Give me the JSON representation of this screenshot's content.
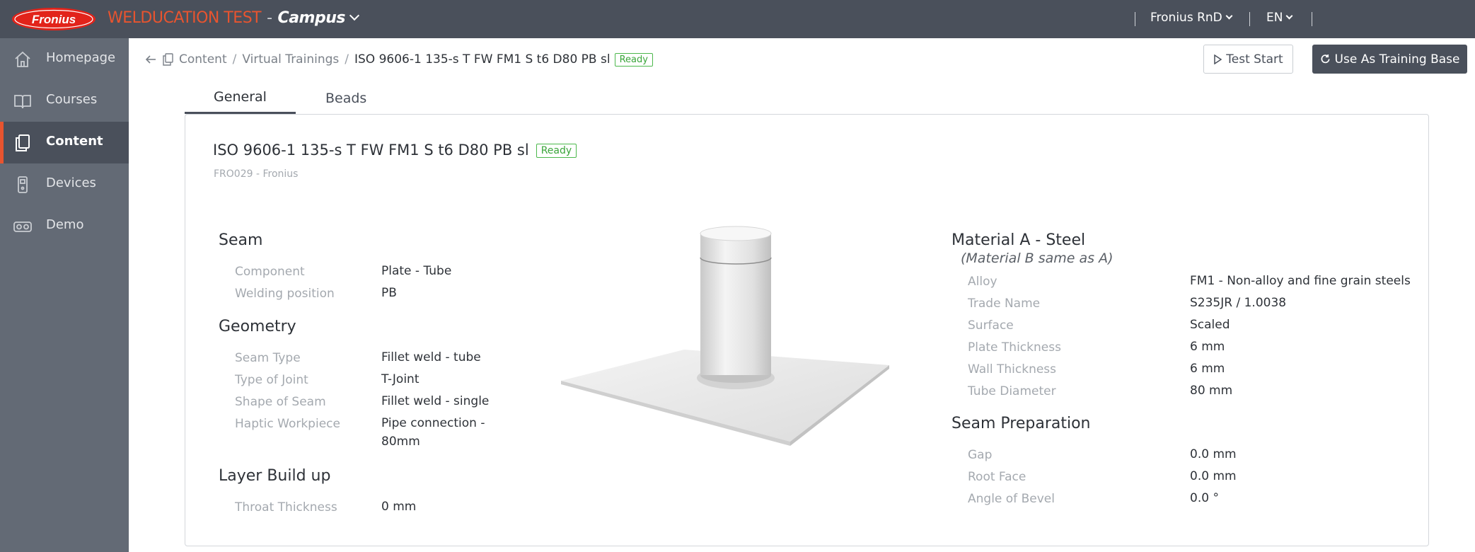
{
  "topbar": {
    "logo_text": "Fronius",
    "app_name": "WELDUCATION TEST",
    "separator": "-",
    "campus": "Campus",
    "org": "Fronius RnD",
    "language": "EN"
  },
  "sidebar": {
    "items": [
      {
        "label": "Homepage",
        "icon": "home-icon"
      },
      {
        "label": "Courses",
        "icon": "book-icon"
      },
      {
        "label": "Content",
        "icon": "content-icon",
        "active": true
      },
      {
        "label": "Devices",
        "icon": "device-icon"
      },
      {
        "label": "Demo",
        "icon": "vr-glasses-icon"
      }
    ]
  },
  "breadcrumb": {
    "items": [
      "Content",
      "Virtual Trainings"
    ],
    "separator": "/",
    "current": "ISO 9606-1 135-s T FW FM1 S t6 D80 PB sl",
    "status": "Ready"
  },
  "actions": {
    "test_start": "Test Start",
    "use_as_training_base": "Use As Training Base"
  },
  "tabs": [
    {
      "label": "General",
      "active": true
    },
    {
      "label": "Beads",
      "active": false
    }
  ],
  "detail": {
    "title": "ISO 9606-1 135-s T FW FM1 S t6 D80 PB sl",
    "status": "Ready",
    "subtitle": "FRO029 - Fronius",
    "seam": {
      "heading": "Seam",
      "rows": [
        {
          "label": "Component",
          "value": "Plate - Tube"
        },
        {
          "label": "Welding position",
          "value": "PB"
        }
      ]
    },
    "geometry": {
      "heading": "Geometry",
      "rows": [
        {
          "label": "Seam Type",
          "value": "Fillet weld - tube"
        },
        {
          "label": "Type of Joint",
          "value": "T-Joint"
        },
        {
          "label": "Shape of Seam",
          "value": "Fillet weld - single"
        },
        {
          "label": "Haptic Workpiece",
          "value": "Pipe connection - 80mm"
        }
      ]
    },
    "layer_build_up": {
      "heading": "Layer Build up",
      "rows": [
        {
          "label": "Throat Thickness",
          "value": "0 mm"
        }
      ]
    },
    "material": {
      "heading": "Material A - Steel",
      "note": "(Material B same as A)",
      "rows": [
        {
          "label": "Alloy",
          "value": "FM1 - Non-alloy and fine grain steels"
        },
        {
          "label": "Trade Name",
          "value": "S235JR / 1.0038"
        },
        {
          "label": "Surface",
          "value": "Scaled"
        },
        {
          "label": "Plate Thickness",
          "value": "6 mm"
        },
        {
          "label": "Wall Thickness",
          "value": "6 mm"
        },
        {
          "label": "Tube Diameter",
          "value": "80 mm"
        }
      ]
    },
    "seam_preparation": {
      "heading": "Seam Preparation",
      "rows": [
        {
          "label": "Gap",
          "value": "0.0 mm"
        },
        {
          "label": "Root Face",
          "value": "0.0 mm"
        },
        {
          "label": "Angle of Bevel",
          "value": "0.0 °"
        }
      ]
    }
  },
  "colors": {
    "topbar": "#4a505b",
    "sidebar": "#636a75",
    "accent": "#e8542f",
    "ready": "#3aa53a"
  }
}
